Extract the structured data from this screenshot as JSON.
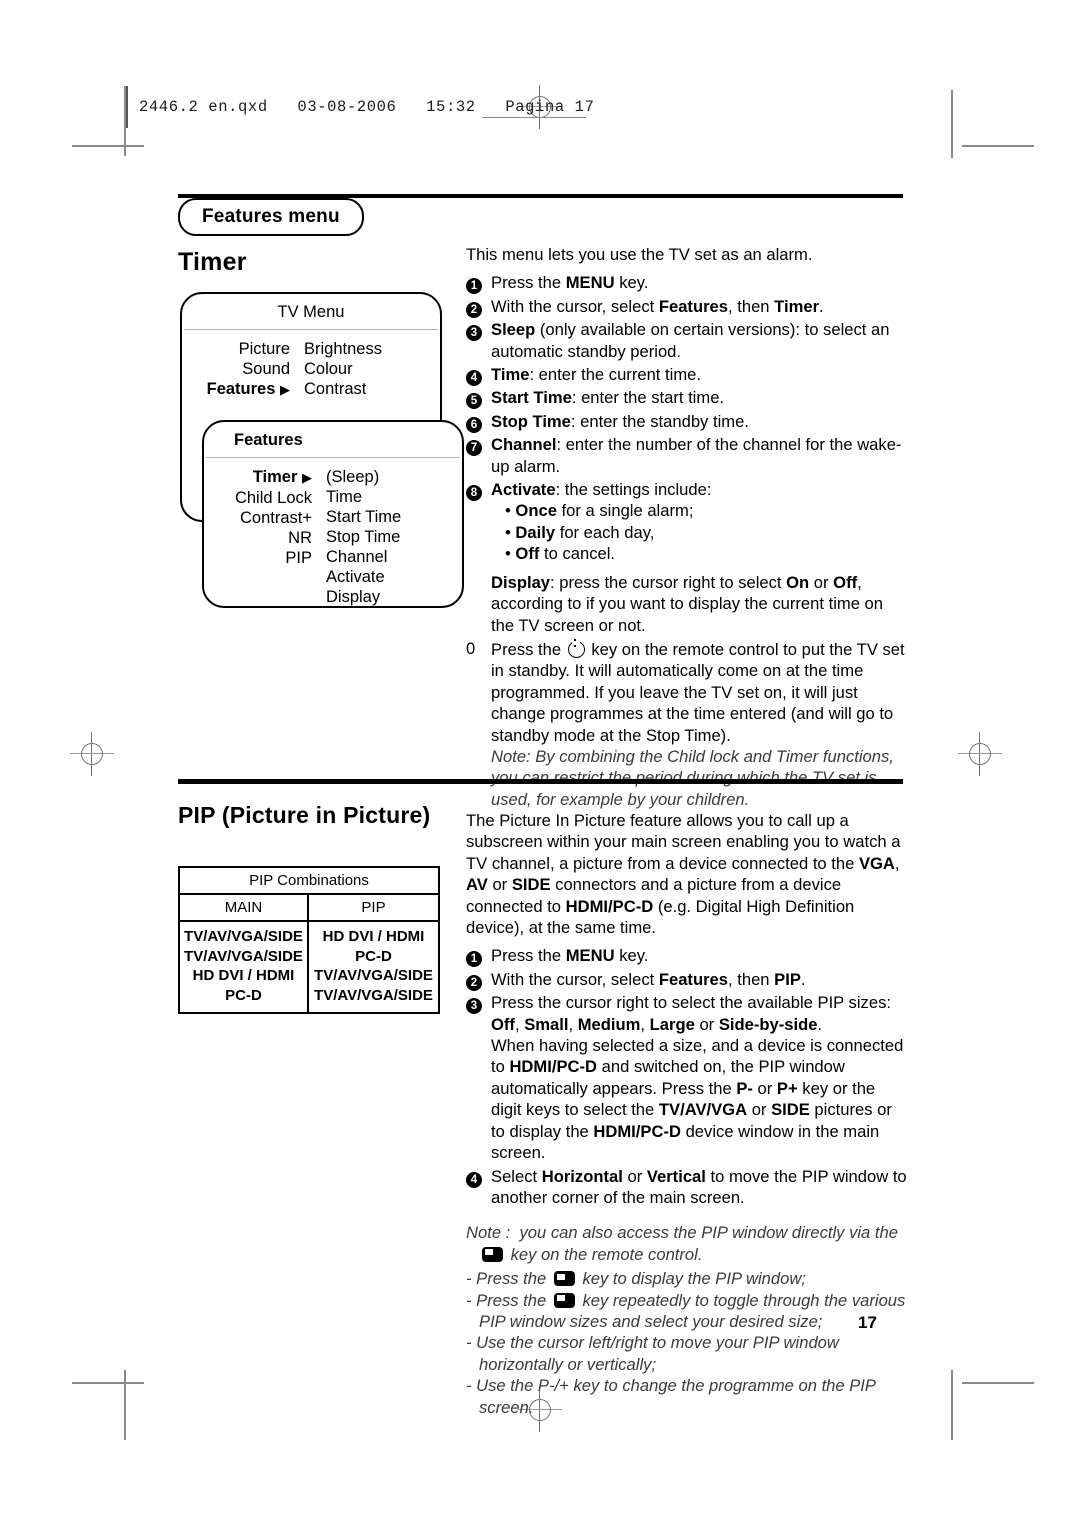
{
  "print_header": {
    "text": "2446.2 en.qxd   03-08-2006   15:32   Pagina 17"
  },
  "page_number": "17",
  "section_badge": "Features menu",
  "timer": {
    "heading": "Timer",
    "intro": "This menu lets you use the TV set as an alarm.",
    "steps": [
      {
        "marker": "1",
        "marker_style": "disc",
        "html": "Press the <b>MENU</b> key."
      },
      {
        "marker": "2",
        "marker_style": "disc",
        "html": "With the cursor, select <b>Features</b>, then <b>Timer</b>."
      },
      {
        "marker": "3",
        "marker_style": "disc",
        "html": "<b>Sleep</b> (only available on certain versions): to select an automatic standby period."
      },
      {
        "marker": "4",
        "marker_style": "disc",
        "html": "<b>Time</b>: enter the current time."
      },
      {
        "marker": "5",
        "marker_style": "disc",
        "html": "<b>Start Time</b>: enter the start time."
      },
      {
        "marker": "6",
        "marker_style": "disc",
        "html": "<b>Stop Time</b>: enter the standby time."
      },
      {
        "marker": "7",
        "marker_style": "disc",
        "html": "<b>Channel</b>: enter the number of the channel for the wake-up alarm."
      },
      {
        "marker": "8",
        "marker_style": "disc",
        "html": "<b>Activate</b>: the settings include:<div class=\"sub\">&bull; <b>Once</b> for a single alarm;</div><div class=\"sub\">&bull; <b>Daily</b> for each day,</div><div class=\"sub\">&bull; <b>Off</b> to cancel.</div><div style=\"height:7px\"></div><div><b>Display</b>: press the cursor right to select <b>On</b> or <b>Off</b>, according to if you want to display the current time on the TV screen or not.</div>"
      },
      {
        "marker": "0",
        "marker_style": "plain",
        "html": "Press the <span class=\"pwr\" data-name=\"power-icon\"></span> key on the remote control to put the TV set in standby. It will automatically come on at the time programmed. If you leave the TV set on, it will just change programmes at the time entered (and will go to standby mode at the Stop Time).<div class=\"note\">Note: By combining the Child lock and Timer functions, you can restrict the period during which the TV set is used, for example by your children.</div>"
      }
    ]
  },
  "tv_menu_diagram": {
    "box1": {
      "title": "TV Menu",
      "left_items": [
        "Picture",
        "Sound",
        "Features"
      ],
      "left_selected": "Features",
      "right_items": [
        "Brightness",
        "Colour",
        "Contrast"
      ]
    },
    "box2": {
      "title": "Features",
      "left_items": [
        "Timer",
        "Child Lock",
        "Contrast+",
        "NR",
        "PIP"
      ],
      "left_selected": "Timer",
      "right_items": [
        "(Sleep)",
        "Time",
        "Start Time",
        "Stop Time",
        "Channel",
        "Activate",
        "Display"
      ]
    },
    "arrow_glyph": "▶"
  },
  "pip": {
    "heading": "PIP (Picture in Picture)",
    "table": {
      "caption": "PIP Combinations",
      "columns": [
        "MAIN",
        "PIP"
      ],
      "rows": [
        [
          "TV/AV/VGA/SIDE",
          "HD DVI / HDMI"
        ],
        [
          "TV/AV/VGA/SIDE",
          "PC-D"
        ],
        [
          "HD DVI / HDMI",
          "TV/AV/VGA/SIDE"
        ],
        [
          "PC-D",
          "TV/AV/VGA/SIDE"
        ]
      ]
    },
    "intro": "The Picture In Picture feature allows you to call up a subscreen within your main screen enabling you to watch a TV channel, a picture from a device connected to the <b>VGA</b>, <b>AV</b> or <b>SIDE</b> connectors and a picture from a device connected to <b>HDMI/PC-D</b> (e.g. Digital High Definition device), at the same time.",
    "steps": [
      {
        "marker": "1",
        "marker_style": "disc",
        "html": "Press the <b>MENU</b> key."
      },
      {
        "marker": "2",
        "marker_style": "disc",
        "html": "With the cursor, select <b>Features</b>, then <b>PIP</b>."
      },
      {
        "marker": "3",
        "marker_style": "disc",
        "html": "Press the cursor right to select the available PIP sizes: <b>Off</b>, <b>Small</b>, <b>Medium</b>, <b>Large</b> or <b>Side-by-side</b>.<div>When having selected a size, and a device is connected to <b>HDMI/PC-D</b> and switched on, the PIP window automatically appears. Press the <b>P-</b> or <b>P+</b> key or the digit keys to select the <b>TV/AV/VGA</b> or <b>SIDE</b> pictures or to display the <b>HDMI/PC-D</b> device window in the main screen.</div>"
      },
      {
        "marker": "4",
        "marker_style": "disc",
        "html": "Select <b>Horizontal</b> or <b>Vertical</b> to move the PIP window to another corner of the main screen."
      }
    ],
    "note_html": "<div class=\"hang\" style=\"margin-bottom:3px\">Note : &nbsp;you can also access the PIP window directly via the <span class=\"pipkey\" data-name=\"pip-key-icon\"></span> key on the remote control.</div><div class=\"hang\">- Press the <span class=\"pipkey\" data-name=\"pip-key-icon\"></span> key to display the PIP window;</div><div class=\"hang\">- Press the <span class=\"pipkey\" data-name=\"pip-key-icon\"></span> key repeatedly to toggle through the various PIP window sizes and select your desired size;</div><div class=\"hang\">- Use the cursor left/right to move your PIP window horizontally or vertically;</div><div class=\"hang\">- Use the P-/+ key to change the programme on the PIP screen.</div>"
  }
}
